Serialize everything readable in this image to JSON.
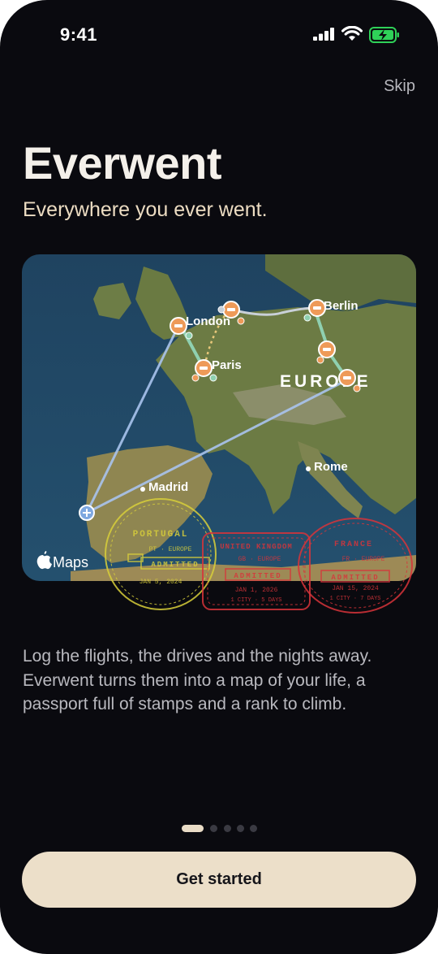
{
  "status_bar": {
    "time": "9:41",
    "battery_color": "#2fd158"
  },
  "header": {
    "skip_label": "Skip"
  },
  "hero": {
    "title": "Everwent",
    "tagline": "Everywhere you ever went."
  },
  "map": {
    "attribution": "Maps",
    "city_labels": {
      "london": "London",
      "paris": "Paris",
      "berlin": "Berlin",
      "rome": "Rome",
      "madrid": "Madrid"
    },
    "region_label": "EUROPE",
    "stamps": {
      "portugal": {
        "country": "PORTUGAL",
        "codes": "PT · EUROPE",
        "status": "ADMITTED",
        "date": "JAN 5, 2024"
      },
      "uk": {
        "country": "UNITED KINGDOM",
        "codes": "GB · EUROPE",
        "status": "ADMITTED",
        "date": "JAN 1, 2026",
        "detail": "1 CITY · 5 DAYS"
      },
      "france": {
        "country": "FRANCE",
        "codes": "FR · EUROPE",
        "status": "ADMITTED",
        "date": "JAN 15, 2024",
        "detail": "1 CITY · 7 DAYS"
      }
    },
    "colors": {
      "stamp_portugal": "#d8cf3a",
      "stamp_uk": "#d8343a",
      "stamp_france": "#d8343a",
      "stay_pin": "#ee9a58",
      "flight_line": "#a9c4ee"
    }
  },
  "body": {
    "description": "Log the flights, the drives and the nights away. Everwent turns them into a map of your life, a passport full of stamps and a rank to climb."
  },
  "pagination": {
    "total": 5,
    "active": 1
  },
  "cta": {
    "label": "Get started"
  }
}
